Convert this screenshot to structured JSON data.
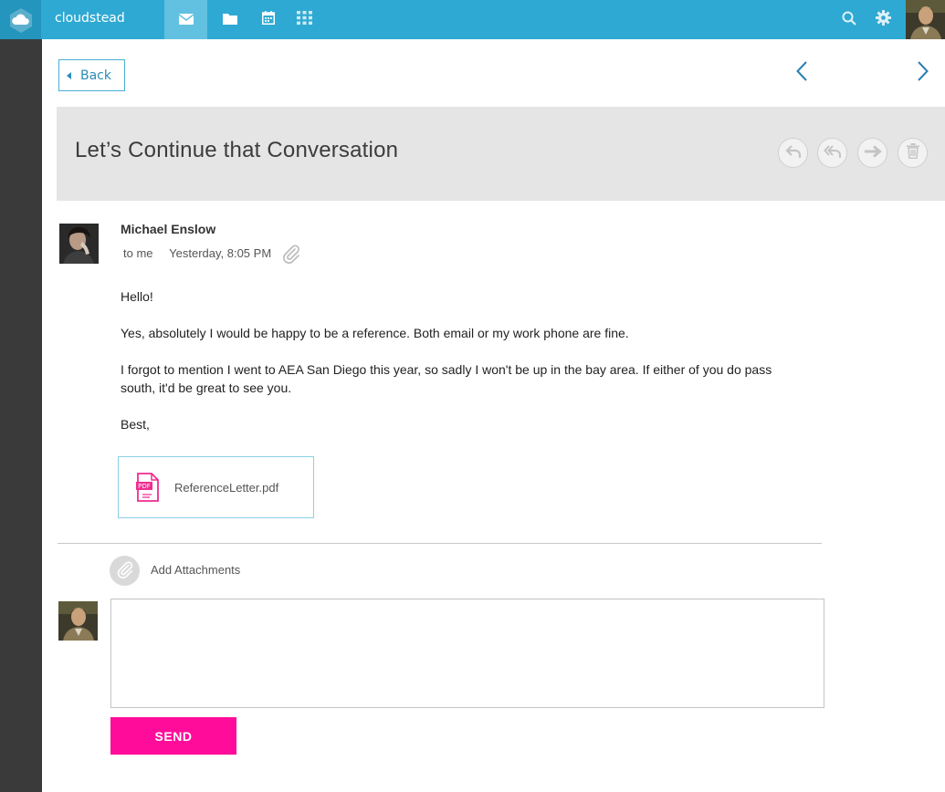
{
  "app": {
    "brand": "cloudstead"
  },
  "colors": {
    "topbar": "#2ea9d3",
    "accent": "#ff0d9a",
    "rail": "#3a3a3a",
    "subject_bg": "#e5e5e5"
  },
  "topnav": {
    "items": [
      {
        "icon": "mail-icon",
        "active": true
      },
      {
        "icon": "folder-icon",
        "active": false
      },
      {
        "icon": "calendar-icon",
        "active": false
      },
      {
        "icon": "apps-grid-icon",
        "active": false
      }
    ],
    "right_icons": [
      "search-icon",
      "gear-icon"
    ]
  },
  "toolbar": {
    "back_label": "Back"
  },
  "message": {
    "subject": "Let’s Continue that Conversation",
    "actions": [
      "reply-icon",
      "reply-all-icon",
      "forward-icon",
      "trash-icon"
    ],
    "sender": "Michael Enslow",
    "recipient": "to me",
    "time": "Yesterday, 8:05 PM",
    "body": [
      "Hello!",
      "Yes, absolutely I would be happy to be a reference. Both email or my work phone are fine.",
      "I forgot to mention I went to AEA San Diego this year, so sadly I won't be up in the bay area. If either of you do pass south, it'd be great to see you.",
      "Best,"
    ],
    "attachment": {
      "filename": "ReferenceLetter.pdf",
      "icon_label": "PDF"
    }
  },
  "reply": {
    "add_attachments_label": "Add Attachments",
    "text_value": "",
    "send_label": "SEND"
  }
}
